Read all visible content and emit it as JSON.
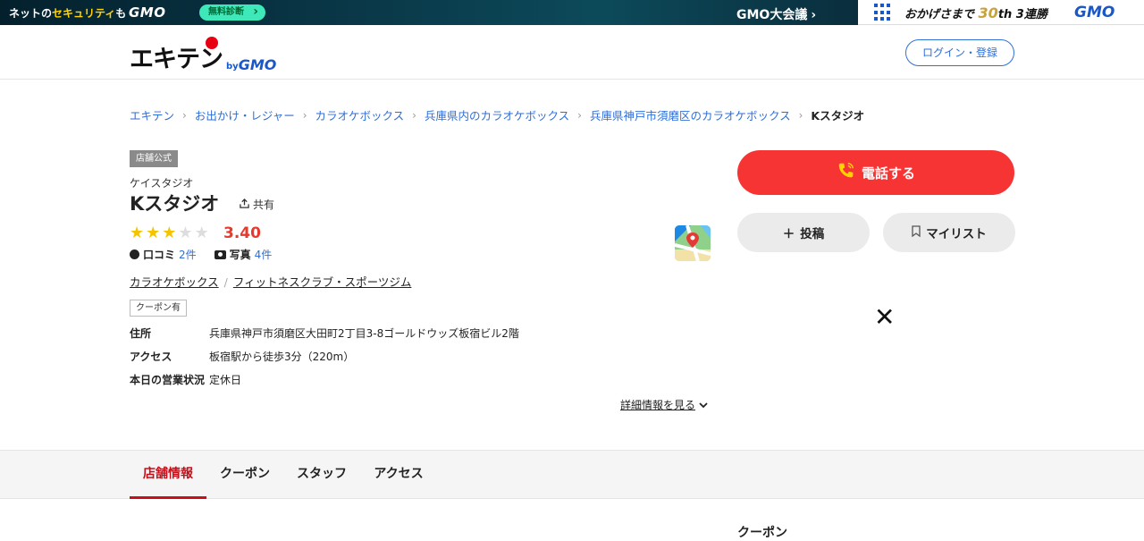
{
  "topbar": {
    "net_text_a": "ネットの",
    "net_text_b": "セキュリティ",
    "net_text_c": "も",
    "gmo_logo": "GMO",
    "diag_button": "無料診断",
    "gmo_conf": "GMO大会議",
    "okage_a": "おかげさまで",
    "okage_30": "30",
    "okage_b": "th 3連勝",
    "gmo_right": "GMO"
  },
  "header": {
    "logo_text": "エキテン",
    "logo_by": "by",
    "logo_gmo": "GMO",
    "login_label": "ログイン・登録"
  },
  "breadcrumb": {
    "items": [
      "エキテン",
      "お出かけ・レジャー",
      "カラオケボックス",
      "兵庫県内のカラオケボックス",
      "兵庫県神戸市須磨区のカラオケボックス"
    ],
    "current": "Kスタジオ"
  },
  "store": {
    "official_badge": "店舗公式",
    "kana": "ケイスタジオ",
    "name": "Kスタジオ",
    "share_label": "共有",
    "rating": "3.40",
    "stars_filled": 3,
    "stars_total": 5,
    "review_label": "口コミ",
    "review_count": "2件",
    "photo_label": "写真",
    "photo_count": "4件",
    "categories": [
      "カラオケボックス",
      "フィットネスクラブ・スポーツジム"
    ],
    "coupon_tag": "クーポン有",
    "info": [
      {
        "key": "住所",
        "value": "兵庫県神戸市須磨区大田町2丁目3-8ゴールドウッズ板宿ビル2階"
      },
      {
        "key": "アクセス",
        "value": "板宿駅から徒歩3分（220m）"
      },
      {
        "key": "本日の営業状況",
        "value": "定休日"
      }
    ],
    "detail_link": "詳細情報を見る"
  },
  "actions": {
    "call": "電話する",
    "post": "投稿",
    "mylist": "マイリスト",
    "call_color": "#f73434"
  },
  "tabs": [
    {
      "label": "店舗情報",
      "active": true
    },
    {
      "label": "クーポン",
      "active": false
    },
    {
      "label": "スタッフ",
      "active": false
    },
    {
      "label": "アクセス",
      "active": false
    }
  ],
  "sidebar": {
    "heading": "クーポン"
  },
  "colors": {
    "accent_blue": "#2f6fd8",
    "rating_red": "#e63a2e",
    "tab_active": "#c8101a",
    "star_yellow": "#f5c400"
  }
}
